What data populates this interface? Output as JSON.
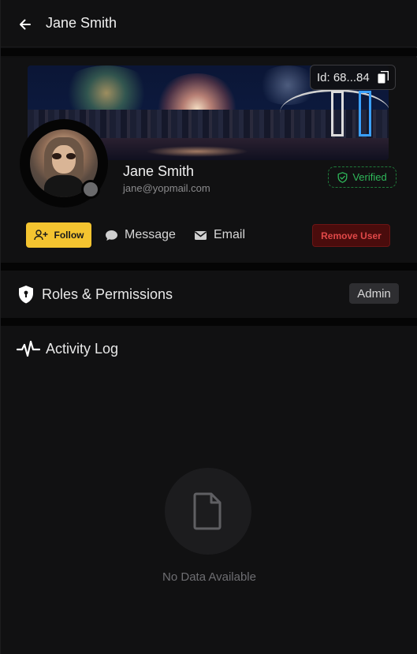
{
  "header": {
    "title": "Jane Smith"
  },
  "profile": {
    "id_label": "Id: 68...84",
    "name": "Jane Smith",
    "email": "jane@yopmail.com",
    "verified_label": "Verified",
    "status": "offline"
  },
  "actions": {
    "follow_label": "Follow",
    "message_label": "Message",
    "email_label": "Email",
    "remove_label": "Remove User"
  },
  "roles": {
    "title": "Roles & Permissions",
    "badge": "Admin"
  },
  "activity": {
    "title": "Activity Log",
    "empty_text": "No Data Available"
  },
  "colors": {
    "background": "#0f0f10",
    "panel": "#111112",
    "accent_yellow": "#f4c430",
    "verified_green": "#2fb85a",
    "danger_red": "#e04848"
  },
  "icons": [
    "arrow-left-icon",
    "copy-icon",
    "shield-check-icon",
    "user-plus-icon",
    "chat-bubble-icon",
    "envelope-icon",
    "shield-lock-icon",
    "pulse-icon",
    "file-icon"
  ]
}
